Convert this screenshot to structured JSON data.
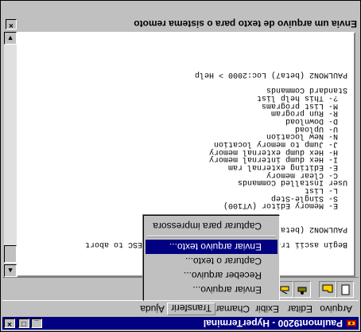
{
  "window": {
    "title": "Paulmont9200 - HyperTerminal",
    "controls": {
      "minimize": "_",
      "maximize": "□",
      "close": "×"
    }
  },
  "menubar": {
    "items": [
      "Arquivo",
      "Editar",
      "Exibir",
      "Chamar",
      "Transferir",
      "Ajuda"
    ],
    "active_index": 4
  },
  "transfer_menu": {
    "items": [
      {
        "label": "Enviar arquivo..."
      },
      {
        "label": "Receber arquivo..."
      },
      {
        "label": "Capturar o texto..."
      },
      {
        "label": "Enviar arquivo texto...",
        "selected": true
      },
      {
        "label": "Capturar para impressora"
      }
    ]
  },
  "toolbar": {
    "icons": [
      "new-connection-icon",
      "open-icon",
      "connect-icon",
      "disconnect-icon",
      "send-icon",
      "properties-icon"
    ]
  },
  "terminal": {
    "lines": [
      "",
      "",
      "",
      "Begin ascii transfer of Intel hex file, or ESC to abort",
      "",
      "PAULMON2 (beta7) Loc:2000 > Download",
      "",
      "",
      "  E- Memory Editor (VT100)",
      "  S- Single-Step",
      "  L- List",
      "User Installed Commands",
      "  C- Clear memory",
      "  E- Editing external ram",
      "  I- Hex dump internal memory",
      "  H- Hex dump external memory",
      "  J- Jump to memory location",
      "  N- New location",
      "  U- Upload",
      "  D- Download",
      "  R- Run program",
      "  M- List programs",
      "  ?- This help list",
      "Standard Commands",
      "",
      "PAULMON2 (beta7) Loc:2000 > Help"
    ]
  },
  "dialog": {
    "title": "Envia um arquivo de texto para o sistema remoto",
    "close": "×"
  },
  "colors": {
    "titlebar": "#000080",
    "face": "#c0c0c0",
    "highlight": "#000080"
  }
}
